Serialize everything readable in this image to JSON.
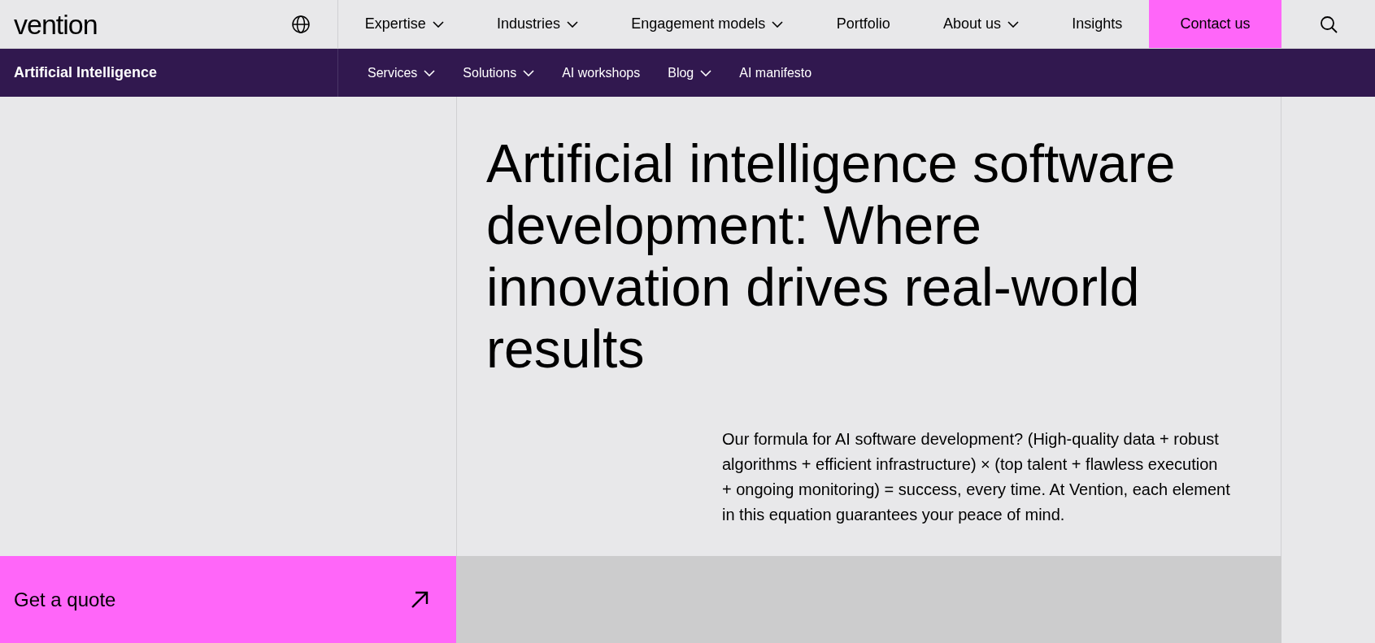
{
  "logo": "vention",
  "main_nav": [
    {
      "label": "Expertise",
      "dropdown": true
    },
    {
      "label": "Industries",
      "dropdown": true
    },
    {
      "label": "Engagement models",
      "dropdown": true
    },
    {
      "label": "Portfolio",
      "dropdown": false
    },
    {
      "label": "About us",
      "dropdown": true
    },
    {
      "label": "Insights",
      "dropdown": false
    }
  ],
  "contact_button": "Contact us",
  "section_title": "Artificial Intelligence",
  "sub_nav": [
    {
      "label": "Services",
      "dropdown": true
    },
    {
      "label": "Solutions",
      "dropdown": true
    },
    {
      "label": "AI workshops",
      "dropdown": false
    },
    {
      "label": "Blog",
      "dropdown": true
    },
    {
      "label": "AI manifesto",
      "dropdown": false
    }
  ],
  "heading": "Artificial intelligence software development: Where innovation drives real-world results",
  "intro": "Our formula for AI software development? (High-quality data + robust algorithms + efficient infrastructure) × (top talent + flawless execution + ongoing monitoring) = success, every time. At Vention, each element in this equation guarantees your peace of mind.",
  "quote_button": "Get a quote"
}
